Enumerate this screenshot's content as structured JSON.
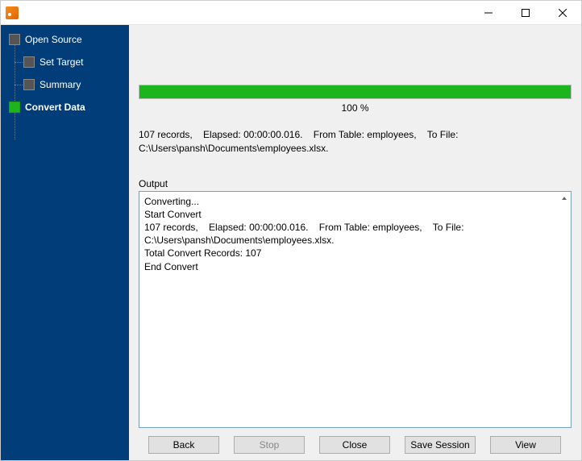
{
  "titlebar": {
    "title": ""
  },
  "sidebar": {
    "items": [
      {
        "label": "Open Source",
        "active": false
      },
      {
        "label": "Set Target",
        "active": false
      },
      {
        "label": "Summary",
        "active": false
      },
      {
        "label": "Convert Data",
        "active": true
      }
    ]
  },
  "progress": {
    "percent": 100,
    "label": "100 %"
  },
  "status_line": "107 records,    Elapsed: 00:00:00.016.    From Table: employees,    To File: C:\\Users\\pansh\\Documents\\employees.xlsx.",
  "output": {
    "label": "Output",
    "text": "Converting...\nStart Convert\n107 records,    Elapsed: 00:00:00.016.    From Table: employees,    To File: C:\\Users\\pansh\\Documents\\employees.xlsx.\nTotal Convert Records: 107\nEnd Convert\n"
  },
  "buttons": {
    "back": "Back",
    "stop": "Stop",
    "close": "Close",
    "save": "Save Session",
    "view": "View"
  }
}
